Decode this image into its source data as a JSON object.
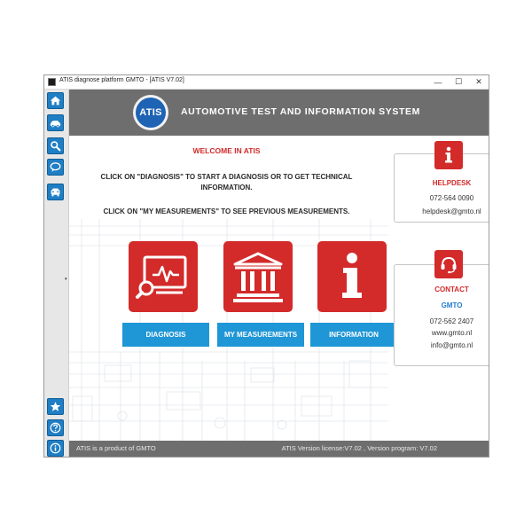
{
  "window": {
    "title": "ATIS diagnose platform GMTO - [ATIS V7.02]",
    "controls": {
      "minimize": "—",
      "maximize": "☐",
      "close": "✕"
    }
  },
  "sidebar": {
    "items": [
      {
        "icon": "home-icon"
      },
      {
        "icon": "car-icon"
      },
      {
        "icon": "search-icon"
      },
      {
        "icon": "chat-icon"
      },
      {
        "icon": "vehicle-icon"
      },
      {
        "icon": "star-icon"
      },
      {
        "icon": "help-icon"
      },
      {
        "icon": "info-icon"
      }
    ],
    "arrow": "▾"
  },
  "header": {
    "logo_text": "ATIS",
    "title": "AUTOMOTIVE TEST AND INFORMATION SYSTEM"
  },
  "welcome": {
    "heading": "WELCOME IN ATIS",
    "line1": "CLICK ON \"DIAGNOSIS\" TO START A DIAGNOSIS OR TO GET TECHNICAL",
    "line2": "INFORMATION.",
    "line3": "CLICK ON \"MY MEASUREMENTS\" TO SEE PREVIOUS MEASUREMENTS."
  },
  "tiles": [
    {
      "icon": "diagnosis-monitor-icon",
      "label": "DIAGNOSIS"
    },
    {
      "icon": "measurements-building-icon",
      "label": "MY MEASUREMENTS"
    },
    {
      "icon": "information-icon",
      "label": "INFORMATION"
    }
  ],
  "helpdesk": {
    "icon": "info-icon",
    "title": "HELPDESK",
    "phone": "072-564 0090",
    "email": "helpdesk@gmto.nl"
  },
  "contact": {
    "icon": "headset-icon",
    "title": "CONTACT",
    "company": "GMTO",
    "phone": "072-562 2407",
    "website": "www.gmto.nl",
    "email": "info@gmto.nl"
  },
  "footer": {
    "left": "ATIS is a product of GMTO",
    "right": "ATIS Version license:V7.02 , Version program: V7.02"
  },
  "colors": {
    "accent_red": "#d32a2a",
    "accent_blue": "#1f96d6",
    "header_gray": "#6e6e6e",
    "sidebar_blue": "#1f7ec4",
    "link_blue": "#1f7ad0"
  }
}
